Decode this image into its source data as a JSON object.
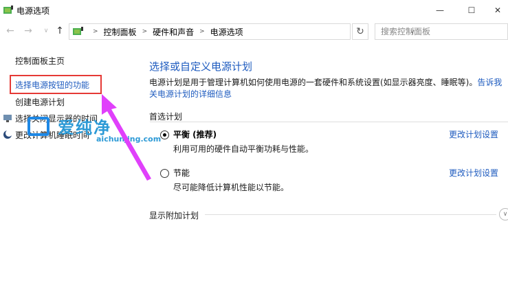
{
  "window": {
    "title": "电源选项",
    "controls": {
      "minimize": "—",
      "maximize": "☐",
      "close": "✕"
    }
  },
  "nav": {
    "back": "←",
    "forward": "→",
    "recent": "∨",
    "up": "↑",
    "breadcrumbs": [
      "控制面板",
      "硬件和声音",
      "电源选项"
    ],
    "refresh": "↻",
    "search_placeholder": "搜索控制面板"
  },
  "sidebar": {
    "items": [
      {
        "label": "控制面板主页"
      },
      {
        "label": "选择电源按钮的功能"
      },
      {
        "label": "创建电源计划"
      },
      {
        "label": "选择关闭显示器的时间"
      },
      {
        "label": "更改计算机睡眠时间"
      }
    ]
  },
  "watermark": {
    "text_cn": "爱纯净",
    "text_en": "aichunjing.com"
  },
  "main": {
    "title": "选择或自定义电源计划",
    "description_1": "电源计划是用于管理计算机如何使用电源的一套硬件和系统设置(如显示器亮度、睡眠等)。",
    "description_link_1": "告诉我",
    "description_link_2": "关电源计划的详细信息",
    "preferred_label": "首选计划",
    "plans": [
      {
        "name": "平衡 (推荐)",
        "description": "利用可用的硬件自动平衡功耗与性能。",
        "link": "更改计划设置",
        "selected": true
      },
      {
        "name": "节能",
        "description": "尽可能降低计算机性能以节能。",
        "link": "更改计划设置",
        "selected": false
      }
    ],
    "additional_label": "显示附加计划",
    "expand": "∨"
  },
  "colors": {
    "link": "#1e5bbf",
    "highlight": "#e53935",
    "arrow": "#e040fb"
  }
}
